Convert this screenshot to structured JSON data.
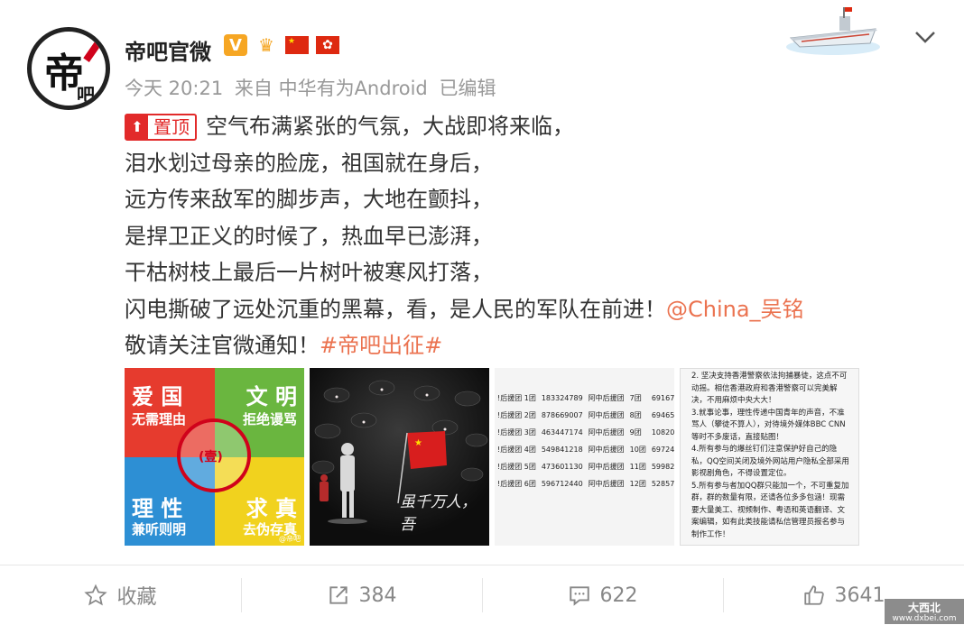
{
  "user": {
    "avatar_text": "帝",
    "avatar_text_small": "吧",
    "name": "帝吧官微",
    "v_badge": "V"
  },
  "meta": {
    "time": "今天 20:21",
    "source": "来自 中华有为Android",
    "edited": "已编辑"
  },
  "post": {
    "pin_label": "置顶",
    "lines": [
      "空气布满紧张的气氛，大战即将来临，",
      "泪水划过母亲的脸庞，祖国就在身后，",
      "远方传来敌军的脚步声，大地在颤抖，",
      "是捍卫正义的时候了，热血早已澎湃，",
      "干枯树枝上最后一片树叶被寒风打落，",
      "闪电撕破了远处沉重的黑幕，看，是人民的军队在前进！"
    ],
    "mention": "@China_吴铭",
    "last_line": "敬请关注官微通知！",
    "hashtag": "#帝吧出征#"
  },
  "thumbs": {
    "t1": {
      "q1_big": "爱 国",
      "q1_small": "无需理由",
      "q2_big": "文 明",
      "q2_small": "拒绝谩骂",
      "q3_big": "理 性",
      "q3_small": "兼听则明",
      "q4_big": "求 真",
      "q4_small": "去伪存真",
      "seal": "(壹)",
      "corner": "@帝吧"
    },
    "t2": {
      "caption": "虽千万人，吾"
    },
    "t3": {
      "rows": [
        [
          "!后援团 1团",
          "183324789",
          "阿中后援团",
          "7团",
          "69167"
        ],
        [
          "!后援团 2团",
          "878669007",
          "阿中后援团",
          "8团",
          "69465"
        ],
        [
          "!后援团 3团",
          "463447174",
          "阿中后援团",
          "9团",
          "10820"
        ],
        [
          "!后援团 4团",
          "549841218",
          "阿中后援团",
          "10团",
          "69724"
        ],
        [
          "!后援团 5团",
          "473601130",
          "阿中后援团",
          "11团",
          "59982"
        ],
        [
          "!后援团 6团",
          "596712440",
          "阿中后援团",
          "12团",
          "52857"
        ]
      ]
    },
    "t4": {
      "paragraphs": [
        "2. 坚决支持香港警察依法拘捕暴徒，这点不可动摇。相信香港政府和香港警察可以完美解决，不用麻烦中央大大！",
        "3.就事论事，理性传递中国青年的声音，不准骂人（攀徒不算人），对待境外媒体BBC CNN等时不多废话，直接贴图！",
        "4.所有参与的爆丝钉们注意保护好自己的隐私，QQ空间关闭及境外网站用户隐私全部采用影视剧角色，不得设置定位。",
        "5.所有参与者加QQ群只能加一个，不可重复加群，群的数量有限，还请各位多多包涵！现需要大量美工、视频制作、粤语和英语翻译、文案编辑，如有此类技能请私信管理员报名参与制作工作！"
      ]
    }
  },
  "footer": {
    "favorite": "收藏",
    "repost": "384",
    "comment": "622",
    "like": "3641"
  },
  "watermark": {
    "line1": "大西北",
    "line2": "www.dxbei.com"
  },
  "colors": {
    "link": "#eb7350",
    "pin": "#e22a2a",
    "meta": "#999999"
  }
}
